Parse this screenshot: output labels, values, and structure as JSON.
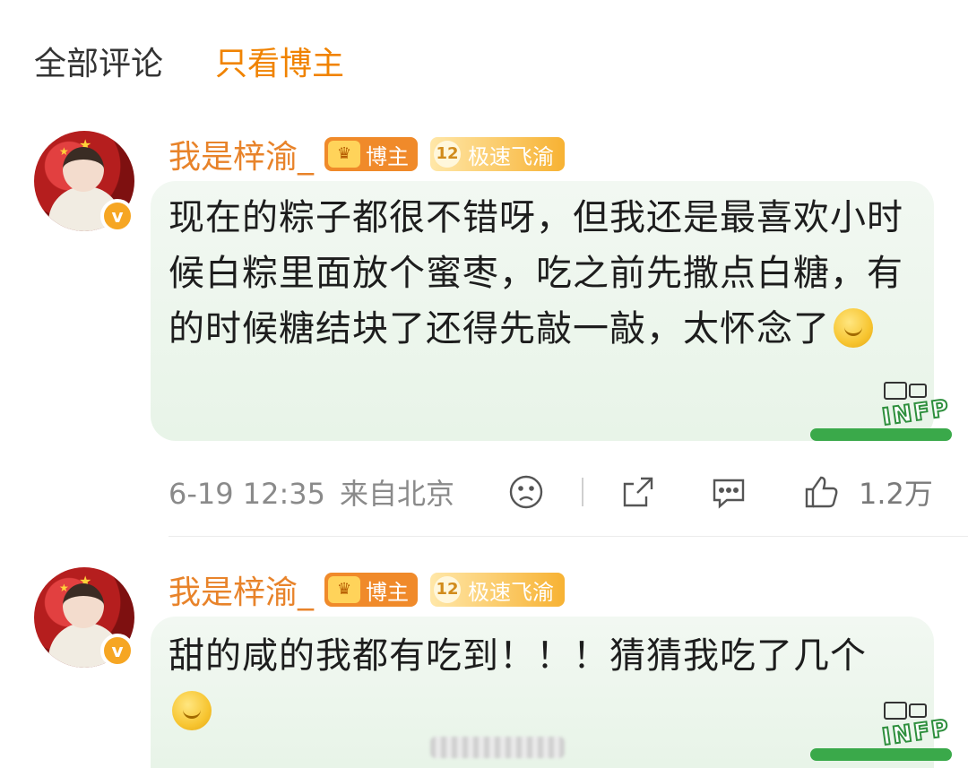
{
  "tabs": {
    "all": "全部评论",
    "blogger": "只看博主"
  },
  "comments": [
    {
      "username": "我是梓渝_",
      "blogger_badge": "博主",
      "level": "12",
      "level_badge": "极速飞渝",
      "text": "现在的粽子都很不错呀，但我还是最喜欢小时候白粽里面放个蜜枣，吃之前先撒点白糖，有的时候糖结块了还得先敲一敲，太怀念了",
      "emoji": "grimace-emoji",
      "date": "6-19",
      "time": "12:35",
      "location": "来自北京",
      "likes": "1.2万",
      "decoration": "INFP"
    },
    {
      "username": "我是梓渝_",
      "blogger_badge": "博主",
      "level": "12",
      "level_badge": "极速飞渝",
      "text": "甜的咸的我都有吃到！！！猜猜我吃了几个",
      "emoji": "thinking-emoji",
      "decoration": "INFP"
    }
  ],
  "colors": {
    "accent": "#f08300",
    "username": "#e8832a",
    "bubble": "#eef6ee",
    "meta": "#8a8a8a"
  }
}
